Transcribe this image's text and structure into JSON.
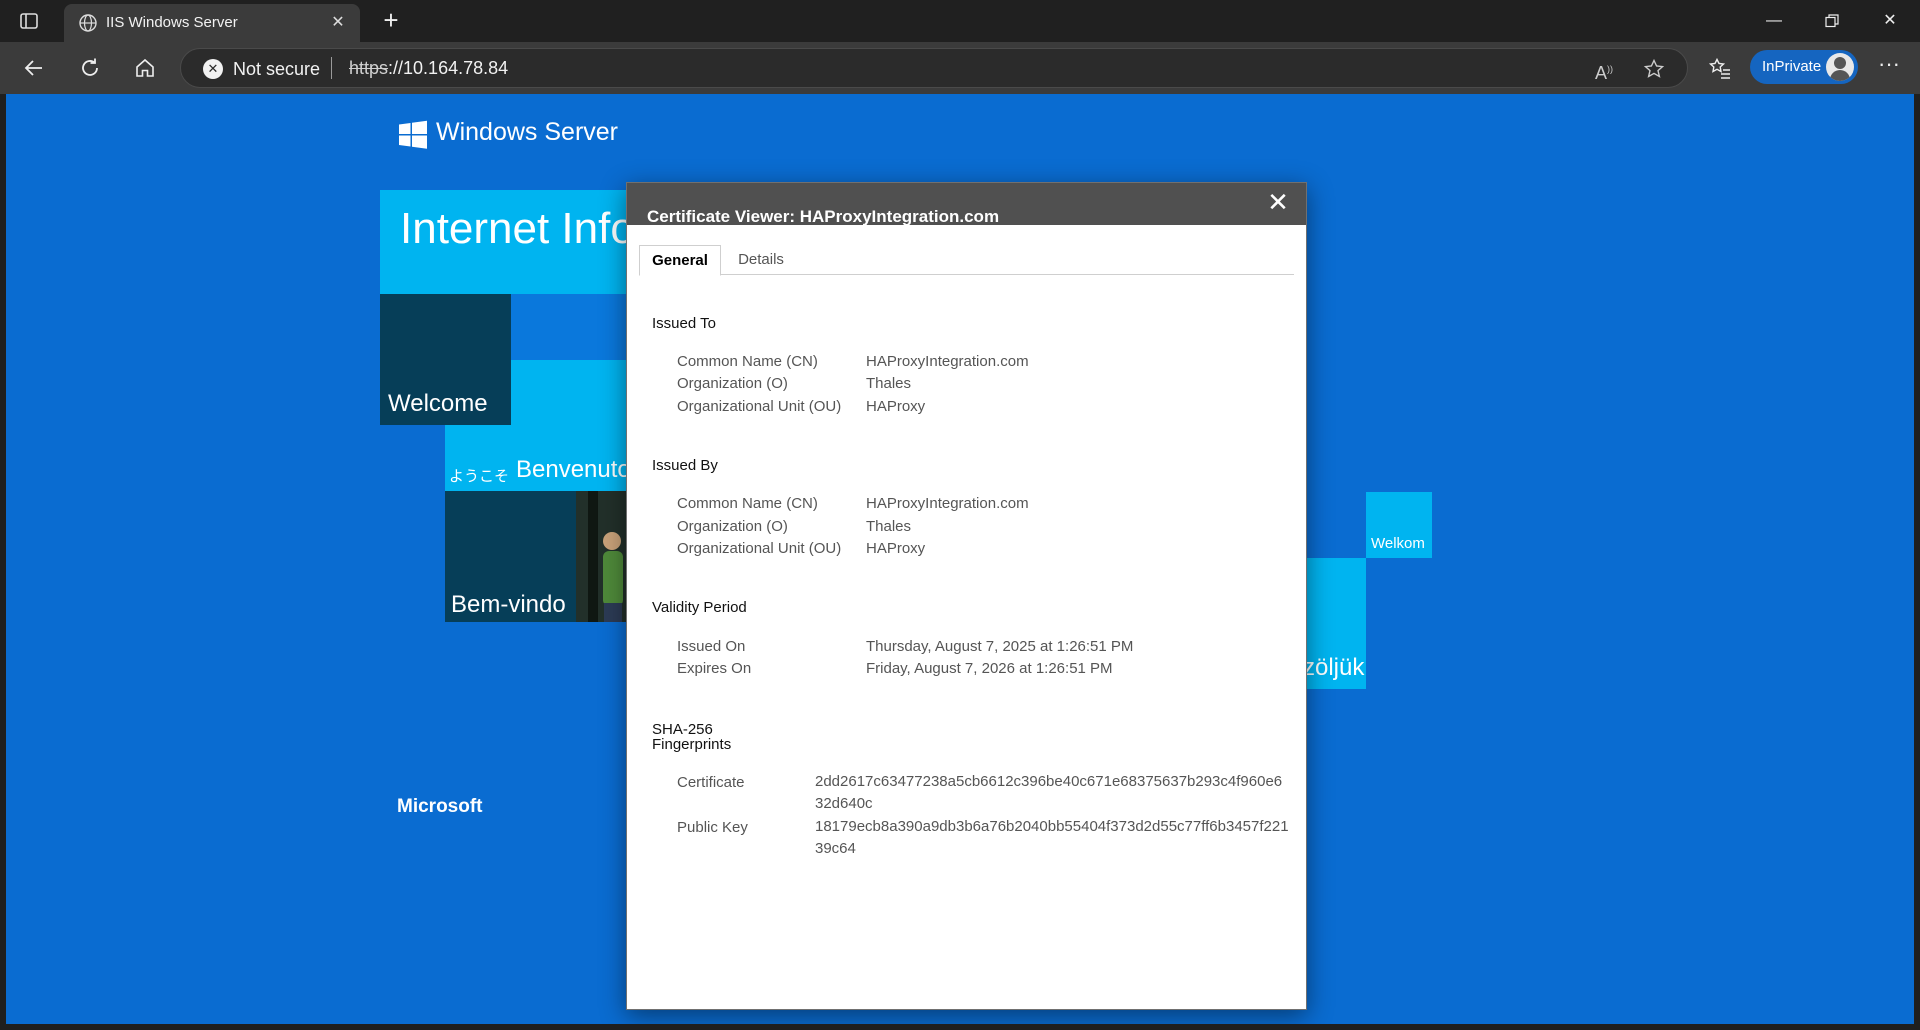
{
  "browser": {
    "tab_title": "IIS Windows Server",
    "security_label": "Not secure",
    "url_scheme": "https",
    "url_rest": "://10.164.78.84",
    "inprivate_label": "InPrivate"
  },
  "page": {
    "brand": "Windows Server",
    "tiles": {
      "internet_info": "Internet Info",
      "welcome": "Welcome",
      "youkoso": "ようこそ",
      "benvenuto": "Benvenuto",
      "bem_vindo": "Bem-vindo",
      "welkom": "Welkom",
      "udvozoljuk": "zöljük"
    },
    "footer_brand": "Microsoft"
  },
  "dialog": {
    "title": "Certificate Viewer: HAProxyIntegration.com",
    "tabs": [
      "General",
      "Details"
    ],
    "issued_to": {
      "heading": "Issued To",
      "rows": [
        {
          "label": "Common Name (CN)",
          "value": "HAProxyIntegration.com"
        },
        {
          "label": "Organization (O)",
          "value": "Thales"
        },
        {
          "label": "Organizational Unit (OU)",
          "value": "HAProxy"
        }
      ]
    },
    "issued_by": {
      "heading": "Issued By",
      "rows": [
        {
          "label": "Common Name (CN)",
          "value": "HAProxyIntegration.com"
        },
        {
          "label": "Organization (O)",
          "value": "Thales"
        },
        {
          "label": "Organizational Unit (OU)",
          "value": "HAProxy"
        }
      ]
    },
    "validity": {
      "heading": "Validity Period",
      "rows": [
        {
          "label": "Issued On",
          "value": "Thursday, August 7, 2025 at 1:26:51 PM"
        },
        {
          "label": "Expires On",
          "value": "Friday, August 7, 2026 at 1:26:51 PM"
        }
      ]
    },
    "fingerprints": {
      "heading_line1": "SHA-256",
      "heading_line2": "Fingerprints",
      "rows": [
        {
          "label": "Certificate",
          "value": "2dd2617c63477238a5cb6612c396be40c671e68375637b293c4f960e632d640c"
        },
        {
          "label": "Public Key",
          "value": "18179ecb8a390a9db3b6a76b2040bb55404f373d2d55c77ff6b3457f22139c64"
        }
      ]
    }
  },
  "colors": {
    "page_background": "#0a6cd1",
    "tile_cyan": "#00b4f0",
    "tile_dark": "#063e58",
    "tile_blue": "#0a78dc",
    "inprivate": "#1565c0"
  },
  "icons": {
    "tab_actions": "tab-actions-icon",
    "globe": "globe-icon",
    "back": "back-arrow-icon",
    "refresh": "refresh-icon",
    "home": "home-icon",
    "read_aloud": "read-aloud-icon",
    "favorite": "star-icon",
    "favorites": "favorites-list-icon"
  }
}
